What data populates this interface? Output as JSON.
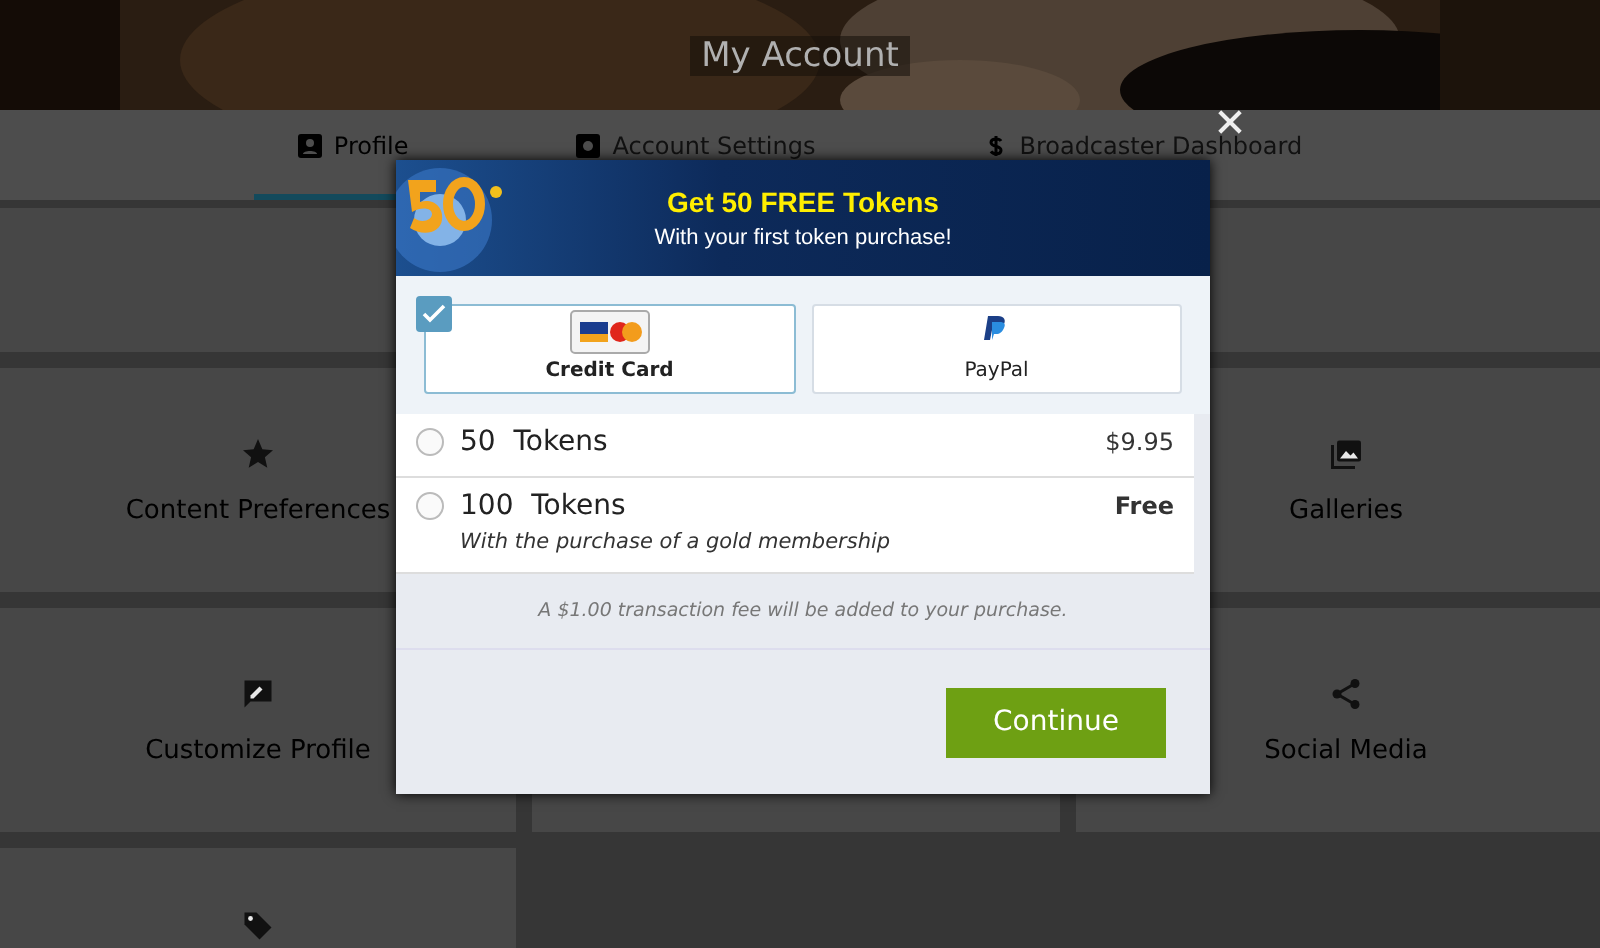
{
  "header": {
    "title": "My Account"
  },
  "tabs": [
    {
      "label": "Profile",
      "selected": true
    },
    {
      "label": "Account Settings",
      "selected": false
    },
    {
      "label": "Broadcaster Dashboard",
      "selected": false
    }
  ],
  "tiles": [
    {
      "kind": "blank"
    },
    {
      "kind": "blank"
    },
    {
      "label": "Content Preferences",
      "kind": "preferences"
    },
    {
      "label": "Galleries",
      "kind": "galleries"
    },
    {
      "label": "Customize Profile",
      "kind": "customize"
    },
    {
      "kind": "blank"
    },
    {
      "label": "Social Media",
      "kind": "social"
    },
    {
      "kind": "tags"
    }
  ],
  "modal": {
    "title": "Get 50 FREE Tokens",
    "subtitle": "With your first token purchase!",
    "payment_methods": [
      {
        "label": "Credit Card",
        "kind": "card",
        "selected": true
      },
      {
        "label": "PayPal",
        "kind": "paypal",
        "selected": false
      }
    ],
    "options": [
      {
        "amount": "50",
        "unit": "Tokens",
        "price": "$9.95",
        "selected": false
      },
      {
        "amount": "100",
        "unit": "Tokens",
        "price": "Free",
        "note": "With the purchase of a gold membership",
        "selected": false
      }
    ],
    "fee_note": "A $1.00 transaction fee will be added to your purchase.",
    "button": "Continue"
  }
}
